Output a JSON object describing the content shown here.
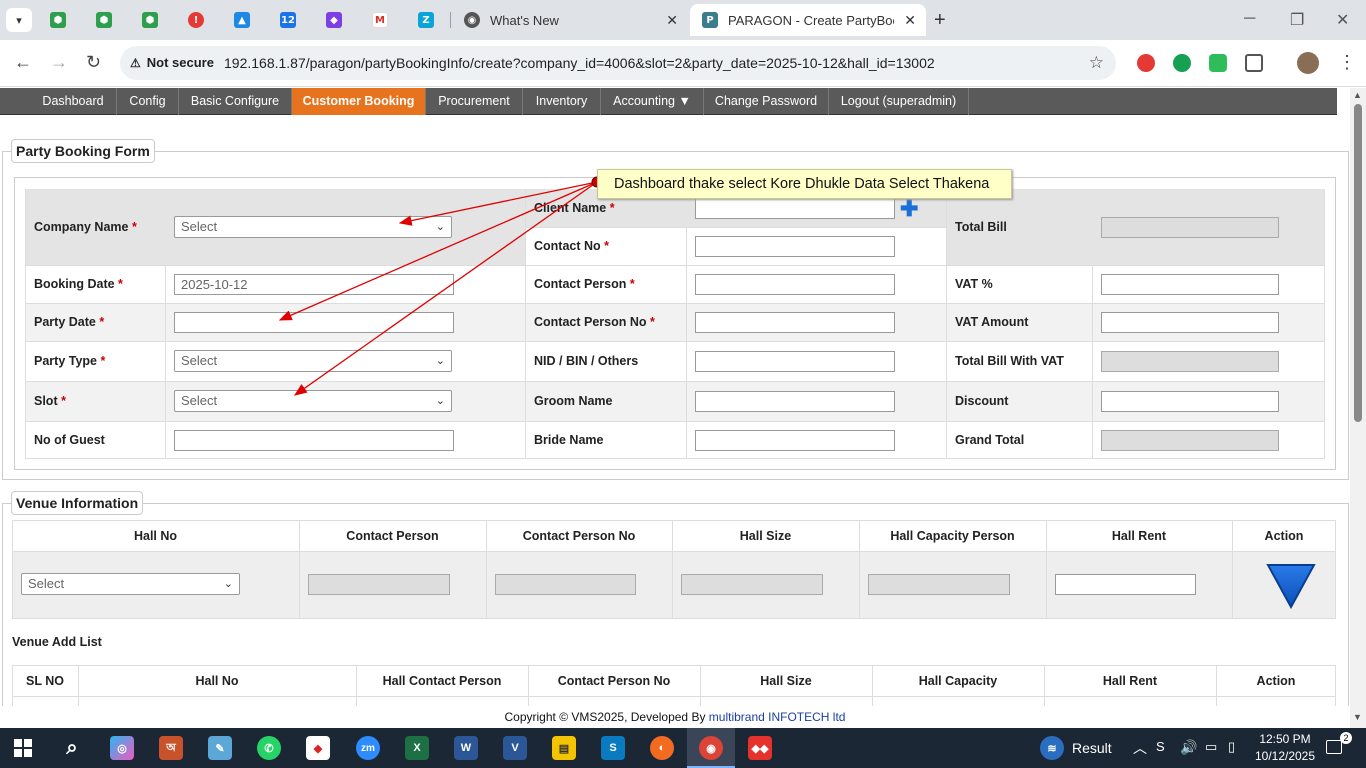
{
  "browser": {
    "tabs": [
      {
        "label": "What's New"
      },
      {
        "label": "PARAGON - Create PartyBooking"
      }
    ],
    "address": {
      "security_label": "Not secure",
      "url": "192.168.1.87/paragon/partyBookingInfo/create?company_id=4006&slot=2&party_date=2025-10-12&hall_id=13002"
    }
  },
  "menu": {
    "items": [
      {
        "label": "Dashboard"
      },
      {
        "label": "Config"
      },
      {
        "label": "Basic Configure"
      },
      {
        "label": "Customer Booking"
      },
      {
        "label": "Procurement"
      },
      {
        "label": "Inventory"
      },
      {
        "label": "Accounting ▼"
      },
      {
        "label": "Change Password"
      },
      {
        "label": "Logout (superadmin)"
      }
    ]
  },
  "annotation": {
    "text": "Dashboard thake select Kore Dhukle Data Select Thakena",
    "color": "#e00000"
  },
  "form": {
    "title": "Party Booking Form",
    "required_mark": "*",
    "company_name": {
      "label": "Company Name",
      "value": "Select"
    },
    "booking_date": {
      "label": "Booking Date",
      "value": "2025-10-12"
    },
    "party_date": {
      "label": "Party Date",
      "value": ""
    },
    "party_type": {
      "label": "Party Type",
      "value": "Select"
    },
    "slot": {
      "label": "Slot",
      "value": "Select"
    },
    "no_of_guest": {
      "label": "No of Guest",
      "value": ""
    },
    "client_name": {
      "label": "Client Name",
      "value": ""
    },
    "contact_no": {
      "label": "Contact No",
      "value": ""
    },
    "contact_person": {
      "label": "Contact Person",
      "value": ""
    },
    "contact_person_no": {
      "label": "Contact Person No",
      "value": ""
    },
    "nid": {
      "label": "NID / BIN / Others",
      "value": ""
    },
    "groom_name": {
      "label": "Groom Name",
      "value": ""
    },
    "bride_name": {
      "label": "Bride Name",
      "value": ""
    },
    "total_bill": {
      "label": "Total Bill",
      "value": ""
    },
    "vat_pct": {
      "label": "VAT %",
      "value": ""
    },
    "vat_amount": {
      "label": "VAT Amount",
      "value": ""
    },
    "total_with_vat": {
      "label": "Total Bill With VAT",
      "value": ""
    },
    "discount": {
      "label": "Discount",
      "value": ""
    },
    "grand_total": {
      "label": "Grand Total",
      "value": ""
    }
  },
  "venue": {
    "title": "Venue Information",
    "headers": [
      "Hall No",
      "Contact Person",
      "Contact Person No",
      "Hall Size",
      "Hall Capacity Person",
      "Hall Rent",
      "Action"
    ],
    "hall_select": "Select",
    "add_list_title": "Venue Add List",
    "list_headers": [
      "SL NO",
      "Hall No",
      "Hall Contact Person",
      "Contact Person No",
      "Hall Size",
      "Hall Capacity",
      "Hall Rent",
      "Action"
    ]
  },
  "footer": {
    "prefix": "Copyright © VMS2025, Developed By ",
    "company": "multibrand INFOTECH ltd"
  },
  "taskbar": {
    "weather": "Result",
    "time": "12:50 PM",
    "date": "10/12/2025",
    "notifications": "2"
  },
  "colors": {
    "menu_bg": "#5a5a5a",
    "menu_active": "#e8731f",
    "accent_blue": "#1a6fd8",
    "row_alt": "#e4e4e4"
  }
}
